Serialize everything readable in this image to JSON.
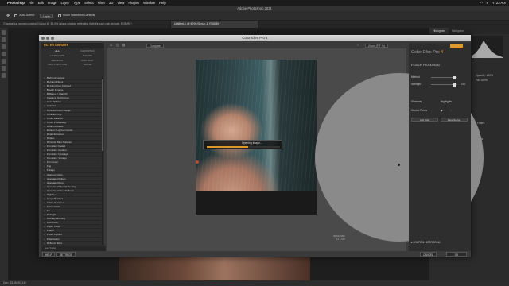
{
  "menubar": {
    "app": "Photoshop",
    "items": [
      "File",
      "Edit",
      "Image",
      "Layer",
      "Type",
      "Select",
      "Filter",
      "3D",
      "View",
      "Plugins",
      "Window",
      "Help"
    ],
    "clock": "Fri 23 Apr"
  },
  "ps": {
    "title": "Adobe Photoshop 2021",
    "options": {
      "auto_select_label": "Auto-Select:",
      "auto_select_value": "Layer",
      "transform_label": "Show Transform Controls"
    },
    "doc_tabs": [
      "G gorgeous woman posing (1).psd @ 33,4% (glass window reflecting light through rain texture, RGB/8) *",
      "Untitled-1 @ 50% (Group 1, RGB/8) *"
    ],
    "right_tabs": [
      "Histogram",
      "Navigator"
    ],
    "right_panel_text": [
      "Opacity: 100%",
      "Fill: 100%",
      "r Filters",
      "Filters"
    ],
    "status": "Doc: 33,6M/93,1M"
  },
  "dialog": {
    "title": "Color Efex Pro 4",
    "filter_library": {
      "header": "FILTER LIBRARY",
      "categories": [
        "ALL",
        "FAVORITES",
        "LANDSCAPE",
        "NATURE",
        "WEDDING",
        "PORTRAIT",
        "ARCHITECTURE",
        "TRAVEL"
      ],
      "filters": [
        "B/W Conversion",
        "Bi-Color Filters",
        "Bi-Color User Defined",
        "Bleach Bypass",
        "Brilliance / Warmth",
        "Classical Soft Focus",
        "Color Stylizer",
        "Colorize",
        "Contrast Color Range",
        "Contrast Only",
        "Cross Balance",
        "Cross Processing",
        "Dark Contrasts",
        "Darken / Lighten Center",
        "Detail Extractor",
        "Duplex",
        "Dynamic Skin Softener",
        "Film Efex: Faded",
        "Film Efex: Modern",
        "Film Efex: Nostalgic",
        "Film Efex: Vintage",
        "Film Grain",
        "Fog",
        "Foliage",
        "Glamour Glow",
        "Graduated Filters",
        "Graduated Fog",
        "Graduated Neutral Density",
        "Graduated User Defined",
        "High Key",
        "Image Borders",
        "Indian Summer",
        "Infrared Film",
        "Ink",
        "Midnight",
        "Monday Morning",
        "Old Photo",
        "Paper Toner",
        "Pastel",
        "Photo Stylizer",
        "Polarization",
        "Reflector Efex"
      ],
      "history_label": "HISTORY"
    },
    "preview": {
      "compare_label": "Compare",
      "zoom_label": "Zoom (FIT %)",
      "loading_text": "Opening image...",
      "loading_progress": 0.56,
      "image_info": [
        "3000x2006",
        "11 1 MP"
      ]
    },
    "settings": {
      "title_a": "Color Efex Pro",
      "title_b": "4",
      "section": "COLOR PROCESSING",
      "method_label": "Method",
      "strength_label": "Strength",
      "strength_value": "100",
      "shadows_label": "Shadows",
      "highlights_label": "Highlights",
      "control_points_label": "Control Points",
      "add_filter_label": "Add Filter",
      "save_recipe_label": "Save Recipe",
      "loupe_label": "LOUPE & HISTOGRAM"
    },
    "buttons": {
      "help": "HELP",
      "settings": "SETTINGS",
      "cancel": "CANCEL",
      "ok": "OK"
    }
  }
}
